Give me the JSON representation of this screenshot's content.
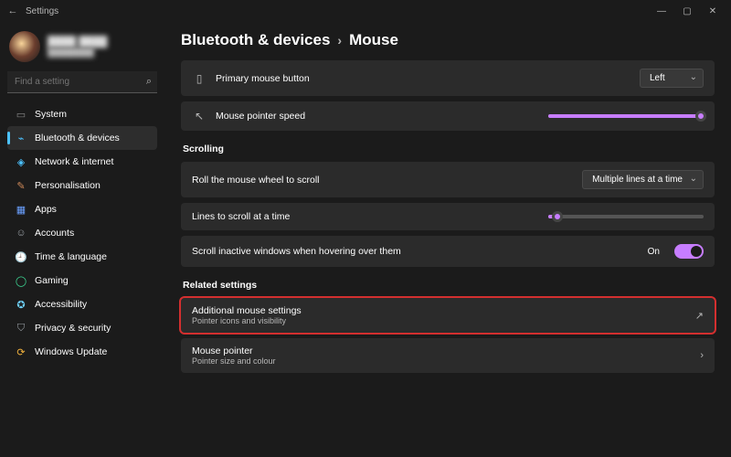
{
  "window": {
    "title": "Settings"
  },
  "profile": {
    "name": "████ ████",
    "email": "████████"
  },
  "search": {
    "placeholder": "Find a setting"
  },
  "sidebar": {
    "items": [
      {
        "label": "System"
      },
      {
        "label": "Bluetooth & devices"
      },
      {
        "label": "Network & internet"
      },
      {
        "label": "Personalisation"
      },
      {
        "label": "Apps"
      },
      {
        "label": "Accounts"
      },
      {
        "label": "Time & language"
      },
      {
        "label": "Gaming"
      },
      {
        "label": "Accessibility"
      },
      {
        "label": "Privacy & security"
      },
      {
        "label": "Windows Update"
      }
    ]
  },
  "breadcrumb": {
    "parent": "Bluetooth & devices",
    "current": "Mouse"
  },
  "mouse_settings": {
    "primary_button": {
      "label": "Primary mouse button",
      "value": "Left"
    },
    "pointer_speed": {
      "label": "Mouse pointer speed",
      "value_pct": 98
    }
  },
  "scrolling": {
    "section": "Scrolling",
    "wheel": {
      "label": "Roll the mouse wheel to scroll",
      "value": "Multiple lines at a time"
    },
    "lines": {
      "label": "Lines to scroll at a time",
      "value_pct": 6
    },
    "inactive": {
      "label": "Scroll inactive windows when hovering over them",
      "state_label": "On",
      "on": true
    }
  },
  "related": {
    "section": "Related settings",
    "items": [
      {
        "title": "Additional mouse settings",
        "sub": "Pointer icons and visibility",
        "action": "external"
      },
      {
        "title": "Mouse pointer",
        "sub": "Pointer size and colour",
        "action": "nav"
      }
    ]
  }
}
